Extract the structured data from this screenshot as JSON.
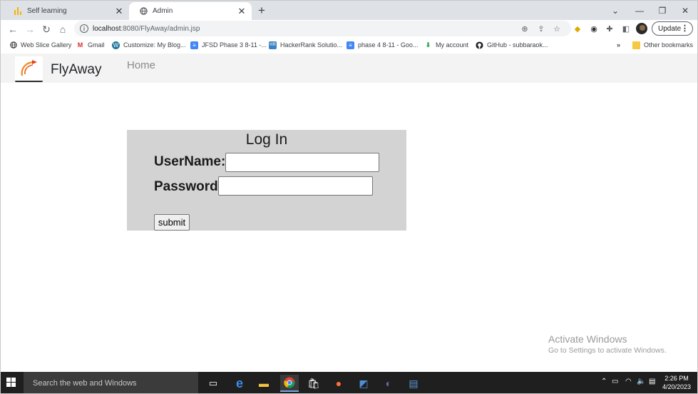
{
  "browser": {
    "tabs": [
      {
        "title": "Self learning",
        "icon": "bar-chart-icon",
        "active": false
      },
      {
        "title": "Admin",
        "icon": "globe-icon",
        "active": true
      }
    ],
    "url_host": "localhost",
    "url_path": ":8080/FlyAway/admin.jsp",
    "update_label": "Update"
  },
  "bookmarks": [
    {
      "label": "Web Slice Gallery",
      "icon": "globe-icon"
    },
    {
      "label": "Gmail",
      "icon": "gmail-icon"
    },
    {
      "label": "Customize: My Blog...",
      "icon": "wordpress-icon"
    },
    {
      "label": "JFSD Phase 3 8-11 -...",
      "icon": "docs-icon"
    },
    {
      "label": "HackerRank Solutio...",
      "icon": "hackerrank-icon"
    },
    {
      "label": "phase 4 8-11 - Goo...",
      "icon": "docs-icon"
    },
    {
      "label": "My account",
      "icon": "download-icon"
    },
    {
      "label": "GitHub - subbaraok...",
      "icon": "github-icon"
    }
  ],
  "bookmarks_overflow": "»",
  "other_bookmarks": "Other bookmarks",
  "navbar": {
    "brand": "FlyAway",
    "home": "Home"
  },
  "login": {
    "title": "Log In",
    "username_label": "UserName:",
    "password_label": "Password:",
    "username_value": "",
    "password_value": "",
    "submit_label": "submit"
  },
  "watermark": {
    "line1": "Activate Windows",
    "line2": "Go to Settings to activate Windows."
  },
  "taskbar": {
    "search_placeholder": "Search the web and Windows",
    "time": "2:26 PM",
    "date": "4/20/2023"
  }
}
